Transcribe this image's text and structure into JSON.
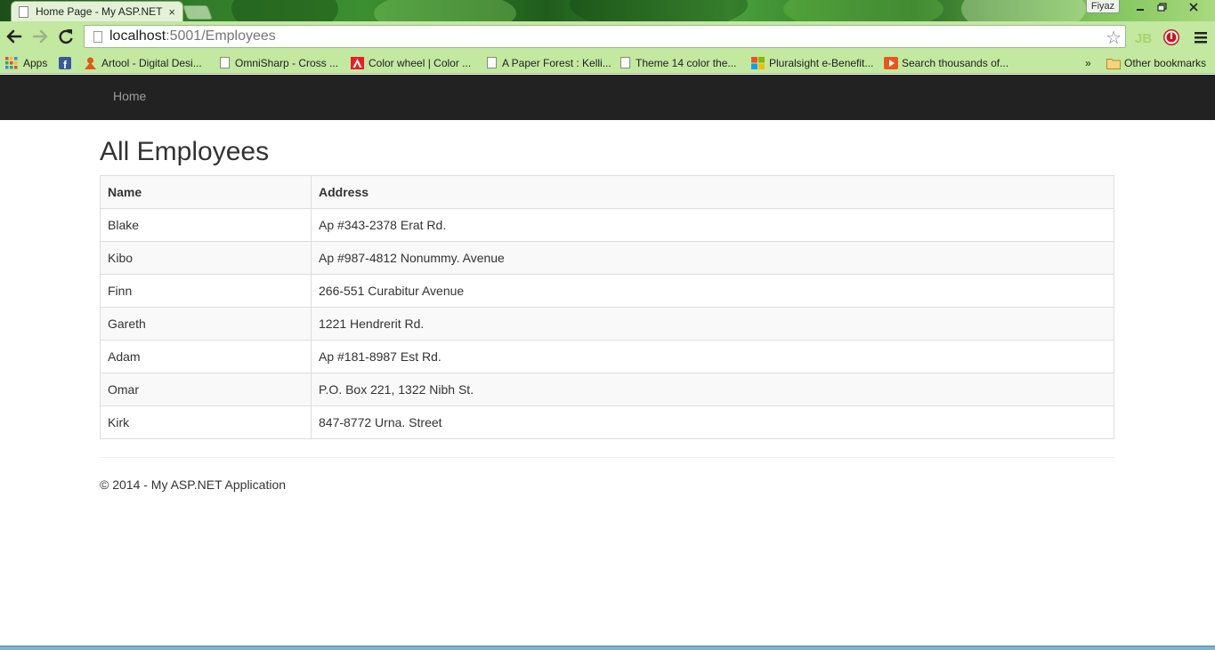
{
  "browser": {
    "tab_title": "Home Page - My ASP.NET",
    "tab_close": "×",
    "user_name": "Fiyaz",
    "url_host": "localhost",
    "url_path": ":5001/Employees",
    "bookmarks": [
      {
        "label": "Apps",
        "icon": "apps-grid-icon"
      },
      {
        "label": "",
        "icon": "facebook-icon"
      },
      {
        "label": "Artool - Digital Desi...",
        "icon": "artool-icon"
      },
      {
        "label": "OmniSharp - Cross ...",
        "icon": "page-icon"
      },
      {
        "label": "Color wheel | Color ...",
        "icon": "adobe-icon"
      },
      {
        "label": "A Paper Forest : Kelli...",
        "icon": "page-icon"
      },
      {
        "label": "Theme 14 color the...",
        "icon": "page-icon"
      },
      {
        "label": "Pluralsight e-Benefit...",
        "icon": "microsoft-icon"
      },
      {
        "label": "Search thousands of...",
        "icon": "play-icon"
      }
    ],
    "bookmarks_overflow": "»",
    "other_bookmarks": "Other bookmarks"
  },
  "navbar": {
    "home_link": "Home"
  },
  "main": {
    "title": "All Employees",
    "table": {
      "headers": [
        "Name",
        "Address"
      ],
      "rows": [
        [
          "Blake",
          "Ap #343-2378 Erat Rd."
        ],
        [
          "Kibo",
          "Ap #987-4812 Nonummy. Avenue"
        ],
        [
          "Finn",
          "266-551 Curabitur Avenue"
        ],
        [
          "Gareth",
          "1221 Hendrerit Rd."
        ],
        [
          "Adam",
          "Ap #181-8987 Est Rd."
        ],
        [
          "Omar",
          "P.O. Box 221, 1322 Nibh St."
        ],
        [
          "Kirk",
          "847-8772 Urna. Street"
        ]
      ]
    }
  },
  "footer": {
    "text": "© 2014 - My ASP.NET Application"
  },
  "colors": {
    "navbar_bg": "#222222",
    "navbar_link": "#9d9d9d",
    "toolbar_bg": "#c3e89f",
    "table_border": "#dddddd",
    "table_stripe": "#f9f9f9"
  }
}
